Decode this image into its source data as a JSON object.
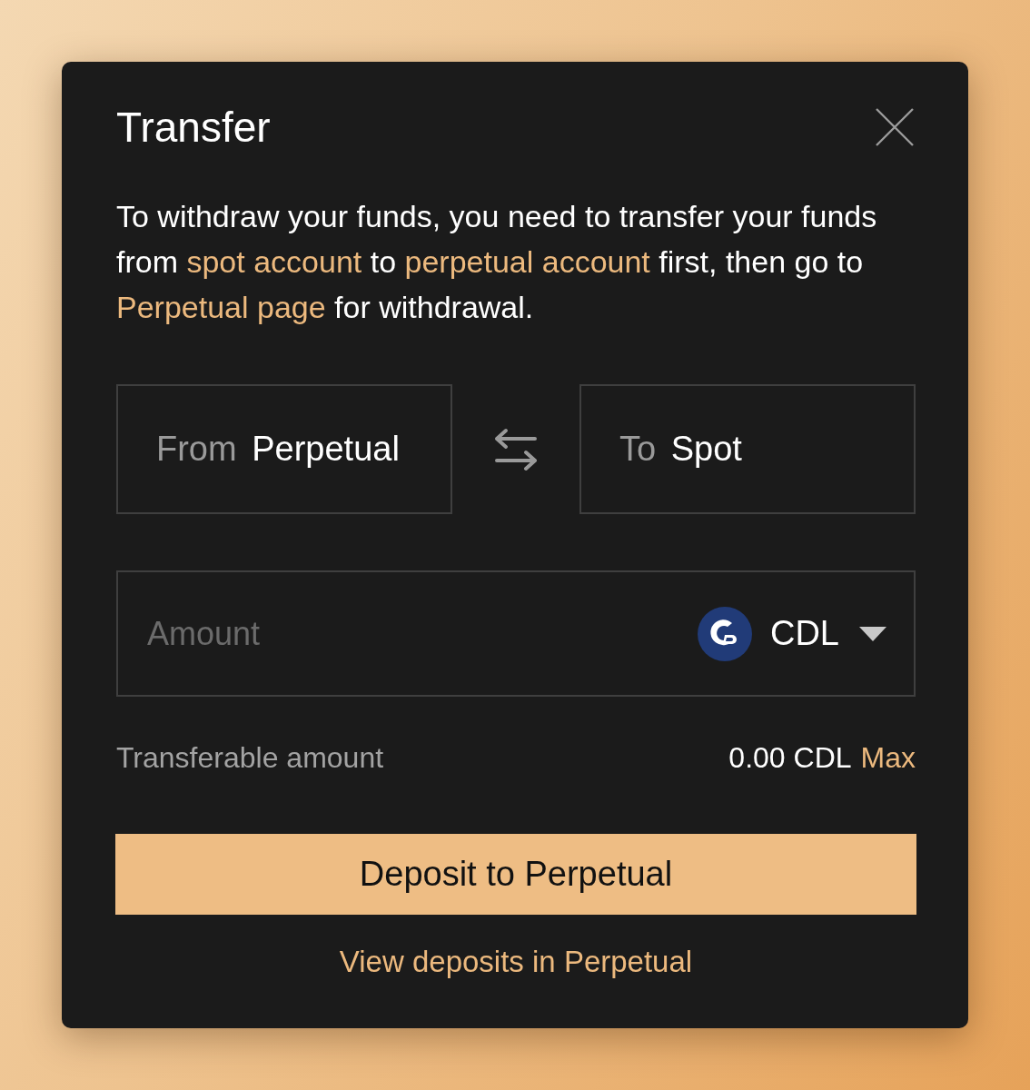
{
  "dialog": {
    "title": "Transfer"
  },
  "notice": {
    "parts": [
      {
        "kind": "text",
        "text": "To withdraw your funds, you need to transfer your funds from "
      },
      {
        "kind": "link",
        "text": "spot account"
      },
      {
        "kind": "text",
        "text": " to "
      },
      {
        "kind": "link",
        "text": "perpetual account"
      },
      {
        "kind": "text",
        "text": " first, then go to "
      },
      {
        "kind": "link",
        "text": "Perpetual page"
      },
      {
        "kind": "text",
        "text": " for withdrawal."
      }
    ]
  },
  "transfer": {
    "from": {
      "label": "From",
      "value": "Perpetual"
    },
    "to": {
      "label": "To",
      "value": "Spot"
    }
  },
  "amount": {
    "placeholder": "Amount",
    "currency": "CDL"
  },
  "transferable": {
    "label": "Transferable amount",
    "value": "0.00 CDL",
    "max": "Max"
  },
  "primary_button": "Deposit to Perpetual",
  "footer_link": "View deposits in Perpetual"
}
